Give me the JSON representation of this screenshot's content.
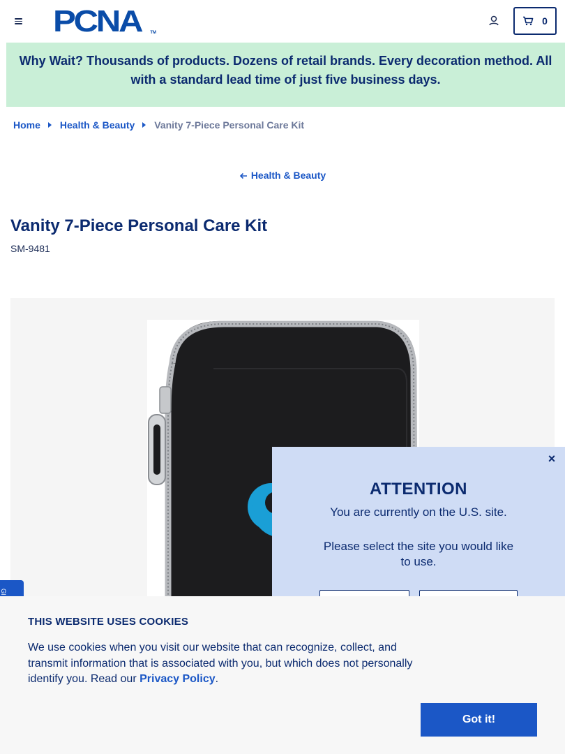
{
  "header": {
    "logo_text": "PCNA",
    "logo_tm": "TM",
    "cart_count": "0"
  },
  "promo": {
    "text": "Why Wait? Thousands of products. Dozens of retail brands. Every decoration method. All with a standard lead time of just five business days."
  },
  "breadcrumb": {
    "items": [
      {
        "label": "Home"
      },
      {
        "label": "Health & Beauty"
      },
      {
        "label": "Vanity 7-Piece Personal Care Kit"
      }
    ]
  },
  "back_link": {
    "label": "Health & Beauty"
  },
  "product": {
    "title": "Vanity 7-Piece Personal Care Kit",
    "sku": "SM-9481"
  },
  "side_tab": {
    "label": "GI"
  },
  "modal": {
    "close_label": "×",
    "title": "ATTENTION",
    "line1": "You are currently on the U.S. site.",
    "line2": "Please select the site you would like to use."
  },
  "cookie": {
    "title": "THIS WEBSITE USES COOKIES",
    "text_before": "We use cookies when you visit our website that can recognize, collect, and transmit information that is associated with you, but which does not personally identify you. Read our ",
    "link_label": "Privacy Policy",
    "text_after": ".",
    "button_label": "Got it!"
  },
  "colors": {
    "navy": "#0b2a6f",
    "link_blue": "#1b57c6",
    "promo_bg": "#c9efd7",
    "modal_bg": "#cfdcf5",
    "logo_blue": "#0a4ca8",
    "product_accent": "#1a9fd6"
  },
  "icons": [
    "menu-icon",
    "account-icon",
    "cart-icon",
    "chevron-right-icon",
    "arrow-left-icon",
    "close-icon"
  ]
}
